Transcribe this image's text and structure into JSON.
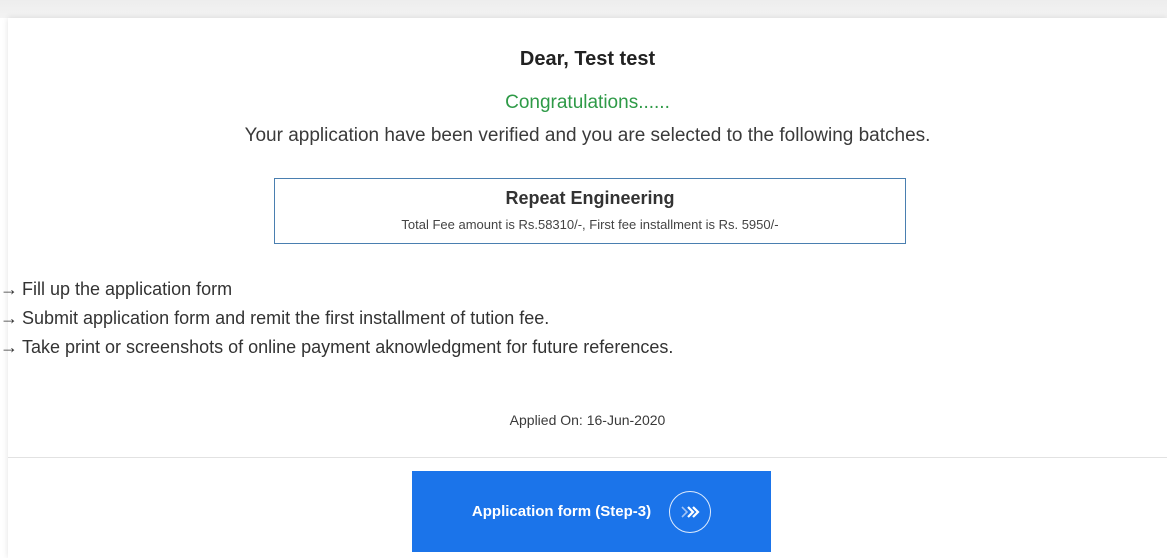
{
  "greeting": "Dear, Test test",
  "congrats": "Congratulations......",
  "message": "Your application have been verified and you are selected to the following batches.",
  "batch": {
    "name": "Repeat Engineering",
    "fee_text": "Total Fee amount is Rs.58310/-, First fee installment is Rs. 5950/-"
  },
  "steps": [
    {
      "icon": "right-arrow-icon",
      "text": "Fill up the application form"
    },
    {
      "icon": "right-arrow-icon",
      "text": "Submit application form and remit the first installment of tution fee."
    },
    {
      "icon": "right-arrow-icon",
      "text": "Take print or screenshots of online payment aknowledgment for future references."
    }
  ],
  "applied_on": "Applied On: 16-Jun-2020",
  "button": {
    "label": "Application form (Step-3)",
    "icon": "double-chevron-right-icon"
  },
  "colors": {
    "accent": "#1b74ea",
    "success": "#2e9a47",
    "box_border": "#4a7fb0"
  }
}
